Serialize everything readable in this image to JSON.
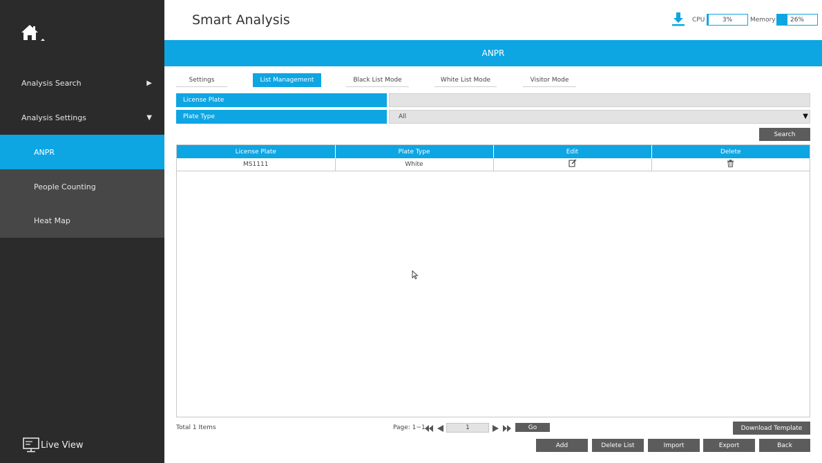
{
  "app": {
    "title": "Smart Analysis"
  },
  "sidebar": {
    "items": [
      {
        "label": "Analysis Search",
        "arrow": "▶"
      },
      {
        "label": "Analysis Settings",
        "arrow": "▼"
      }
    ],
    "sub_items": [
      {
        "label": "ANPR",
        "active": true
      },
      {
        "label": "People Counting",
        "active": false
      },
      {
        "label": "Heat Map",
        "active": false
      }
    ],
    "live_view": "Live View"
  },
  "status": {
    "cpu_label": "CPU",
    "cpu_value": "3%",
    "cpu_fraction": 0.03,
    "memory_label": "Memory",
    "memory_value": "26%",
    "memory_fraction": 0.26
  },
  "banner": {
    "title": "ANPR"
  },
  "tabs": [
    {
      "label": "Settings",
      "active": false
    },
    {
      "label": "List Management",
      "active": true
    },
    {
      "label": "Black List Mode",
      "active": false
    },
    {
      "label": "White List Mode",
      "active": false
    },
    {
      "label": "Visitor Mode",
      "active": false
    }
  ],
  "filters": {
    "license_plate_label": "License Plate",
    "license_plate_value": "",
    "plate_type_label": "Plate Type",
    "plate_type_value": "All",
    "search_label": "Search"
  },
  "table": {
    "columns": [
      "License Plate",
      "Plate Type",
      "Edit",
      "Delete"
    ],
    "rows": [
      {
        "license_plate": "MS1111",
        "plate_type": "White"
      }
    ]
  },
  "footer": {
    "total": "Total 1 Items",
    "page_label": "Page: 1~1",
    "page_value": "1",
    "go_label": "Go",
    "download_template": "Download Template",
    "buttons": [
      "Add",
      "Delete List",
      "Import",
      "Export",
      "Back"
    ]
  },
  "colors": {
    "accent": "#0ea5e3",
    "sidebar": "#2b2b2b",
    "sub_item": "#474747",
    "button": "#5c5c5c"
  }
}
